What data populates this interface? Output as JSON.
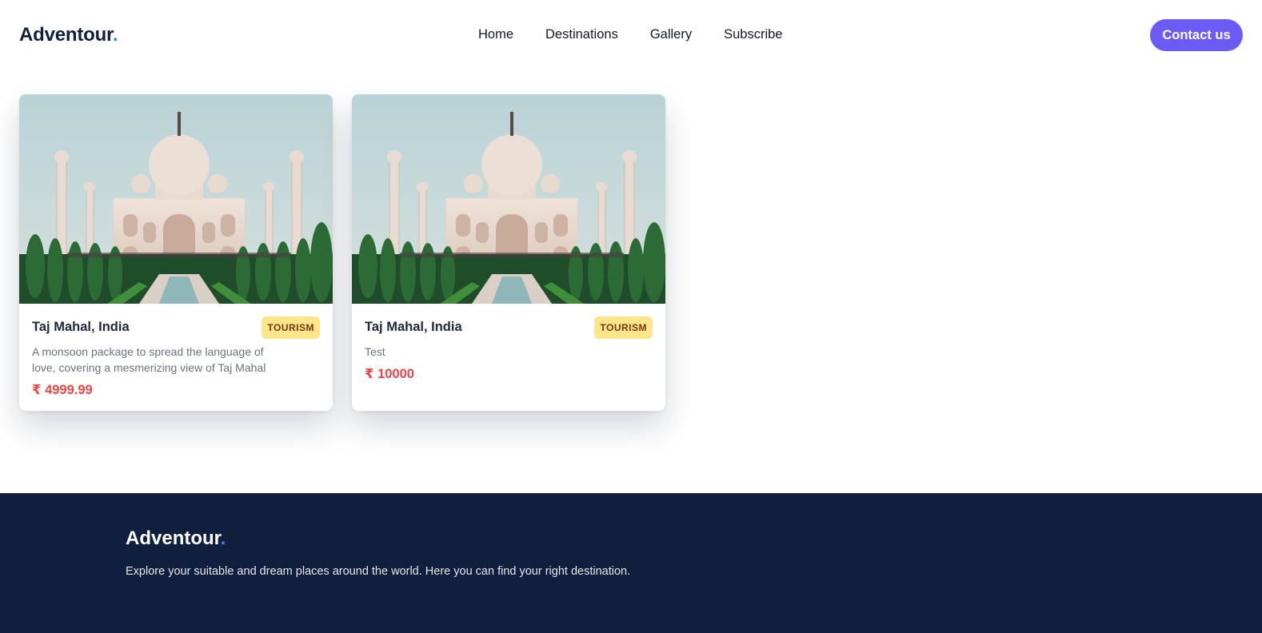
{
  "header": {
    "logo_text": "Adventour",
    "logo_dot": ".",
    "nav": [
      "Home",
      "Destinations",
      "Gallery",
      "Subscribe"
    ],
    "contact_label": "Contact us"
  },
  "cards": [
    {
      "title": "Taj Mahal, India",
      "badge": "TOURISM",
      "description": "A monsoon package to spread the language of love, covering a mesmerizing view of Taj Mahal",
      "price": "₹ 4999.99"
    },
    {
      "title": "Taj Mahal, India",
      "badge": "TOURISM",
      "description": "Test",
      "price": "₹ 10000"
    }
  ],
  "footer": {
    "logo_text": "Adventour",
    "logo_dot": ".",
    "tagline": "Explore your suitable and dream places around the world. Here you can find your right destination."
  },
  "colors": {
    "brand_navy": "#0f1f3d",
    "accent_purple": "#6b5cf6",
    "accent_blue_dot": "#3b82f6",
    "badge_yellow": "#fde68a",
    "price_red": "#ef4444"
  }
}
